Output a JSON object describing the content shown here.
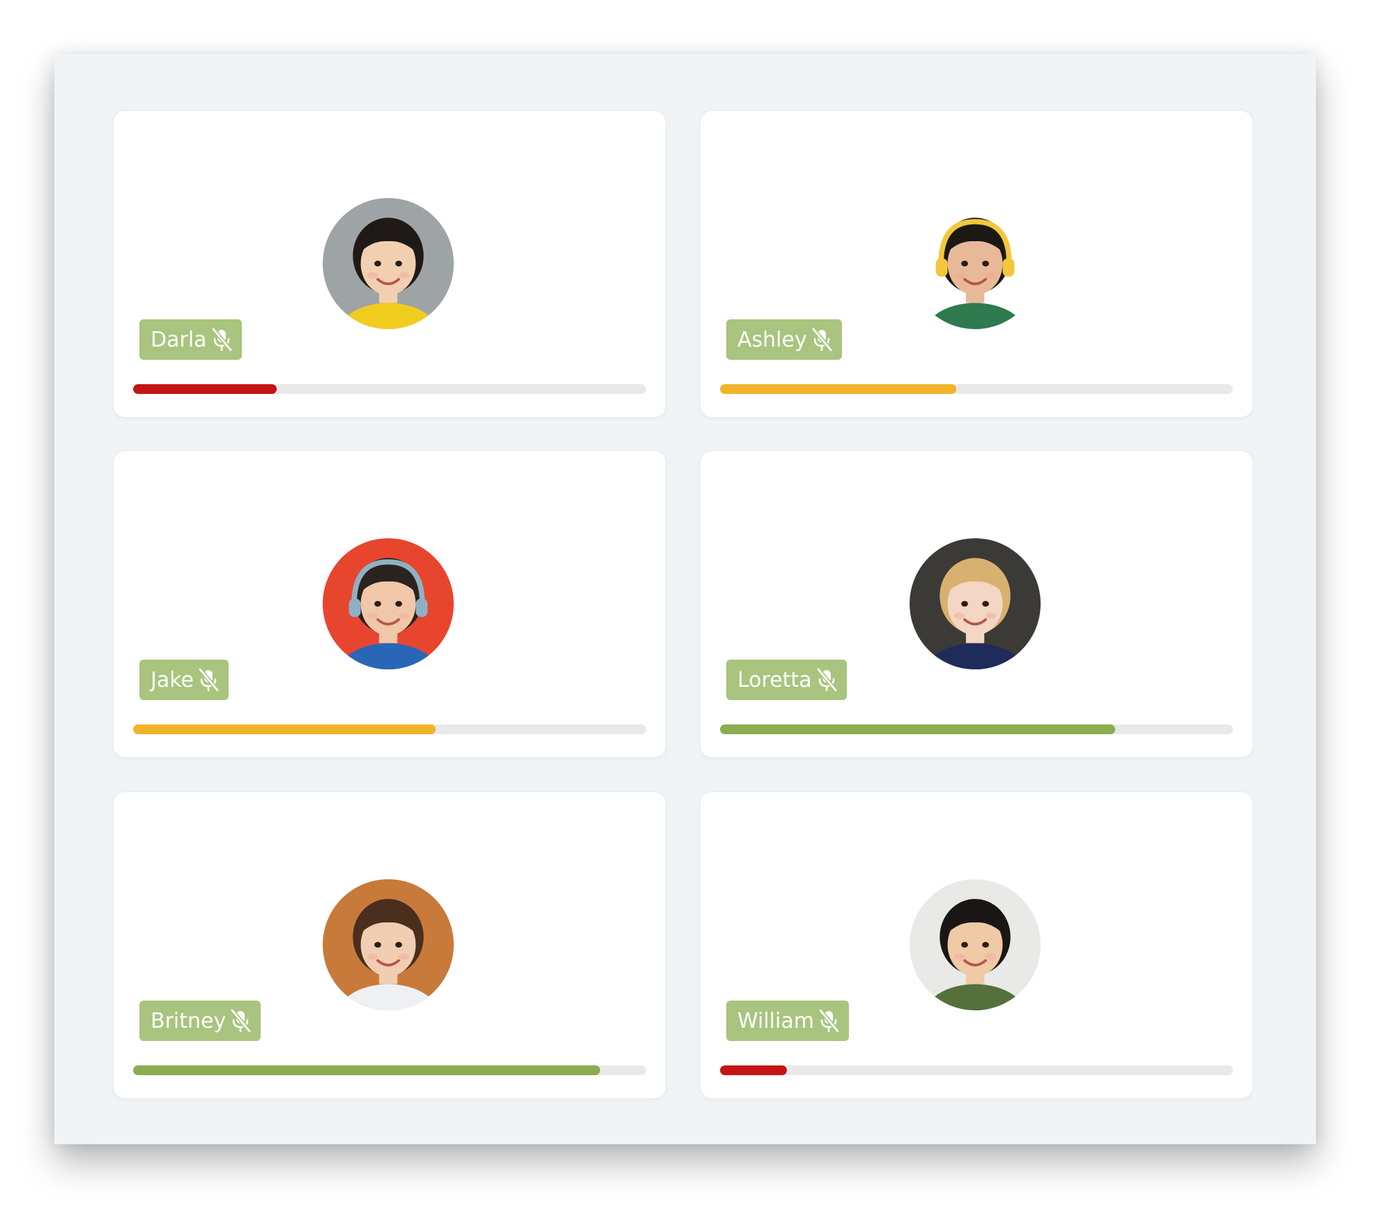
{
  "participants": [
    {
      "name": "Darla",
      "mic": "mic-muted-icon",
      "level": 0.28,
      "bar_color": "#c41515",
      "avatar": {
        "bg": "#9ea3a6",
        "skin": "#f2cfb0",
        "hair": "#1f1a17",
        "shirt": "#f0cc1e"
      }
    },
    {
      "name": "Ashley",
      "mic": "mic-muted-icon",
      "level": 0.46,
      "bar_color": "#f0b429",
      "avatar": {
        "bg": "#ffffff",
        "skin": "#e8b998",
        "hair": "#1c1816",
        "shirt": "#2f7a4f",
        "headphones": "#f2c83a"
      }
    },
    {
      "name": "Jake",
      "mic": "mic-muted-icon",
      "level": 0.59,
      "bar_color": "#f0b429",
      "avatar": {
        "bg": "#e8452f",
        "skin": "#f0c7a8",
        "hair": "#2a2320",
        "shirt": "#2a66b8",
        "headphones": "#8fb1c4"
      }
    },
    {
      "name": "Loretta",
      "mic": "mic-muted-icon",
      "level": 0.77,
      "bar_color": "#8bac4f",
      "avatar": {
        "bg": "#3b3a36",
        "skin": "#f3d6c3",
        "hair": "#d8b170",
        "shirt": "#1f2b5a"
      }
    },
    {
      "name": "Britney",
      "mic": "mic-muted-icon",
      "level": 0.91,
      "bar_color": "#8bac4f",
      "avatar": {
        "bg": "#c87a3a",
        "skin": "#f1cdb2",
        "hair": "#4a2e1e",
        "shirt": "#eef0f4"
      }
    },
    {
      "name": "William",
      "mic": "mic-muted-icon",
      "level": 0.13,
      "bar_color": "#c41515",
      "avatar": {
        "bg": "#e9eae8",
        "skin": "#f0c9a6",
        "hair": "#1a1613",
        "shirt": "#55703a"
      }
    }
  ]
}
